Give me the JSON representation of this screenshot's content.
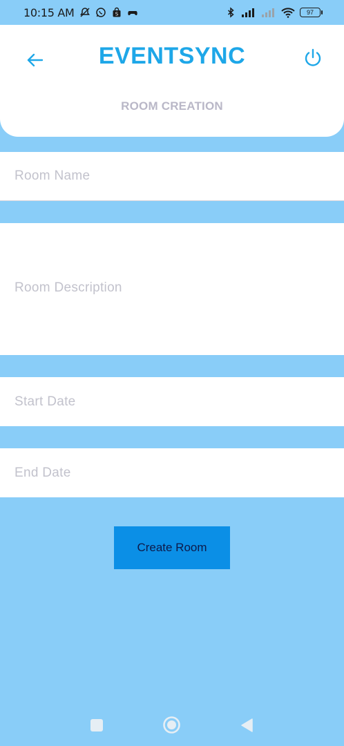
{
  "status_bar": {
    "time": "10:15 AM",
    "battery": "97",
    "left_icons": [
      "mute-bell-icon",
      "whatsapp-icon",
      "shopping-bag-icon",
      "gamepad-icon"
    ],
    "right_icons": [
      "bluetooth-icon",
      "signal-icon",
      "signal-weak-icon",
      "wifi-icon",
      "battery-icon"
    ]
  },
  "header": {
    "title": "EVENTSYNC",
    "subtitle": "ROOM CREATION",
    "back_icon": "arrow-left-icon",
    "power_icon": "power-icon"
  },
  "form": {
    "room_name_placeholder": "Room Name",
    "room_description_placeholder": "Room Description",
    "start_date_placeholder": "Start Date",
    "end_date_placeholder": "End Date"
  },
  "actions": {
    "create_room_label": "Create Room"
  },
  "colors": {
    "background": "#89cdf8",
    "title": "#1ea7e8",
    "button": "#0b8fe6",
    "subtitle": "#b9b7c7"
  }
}
